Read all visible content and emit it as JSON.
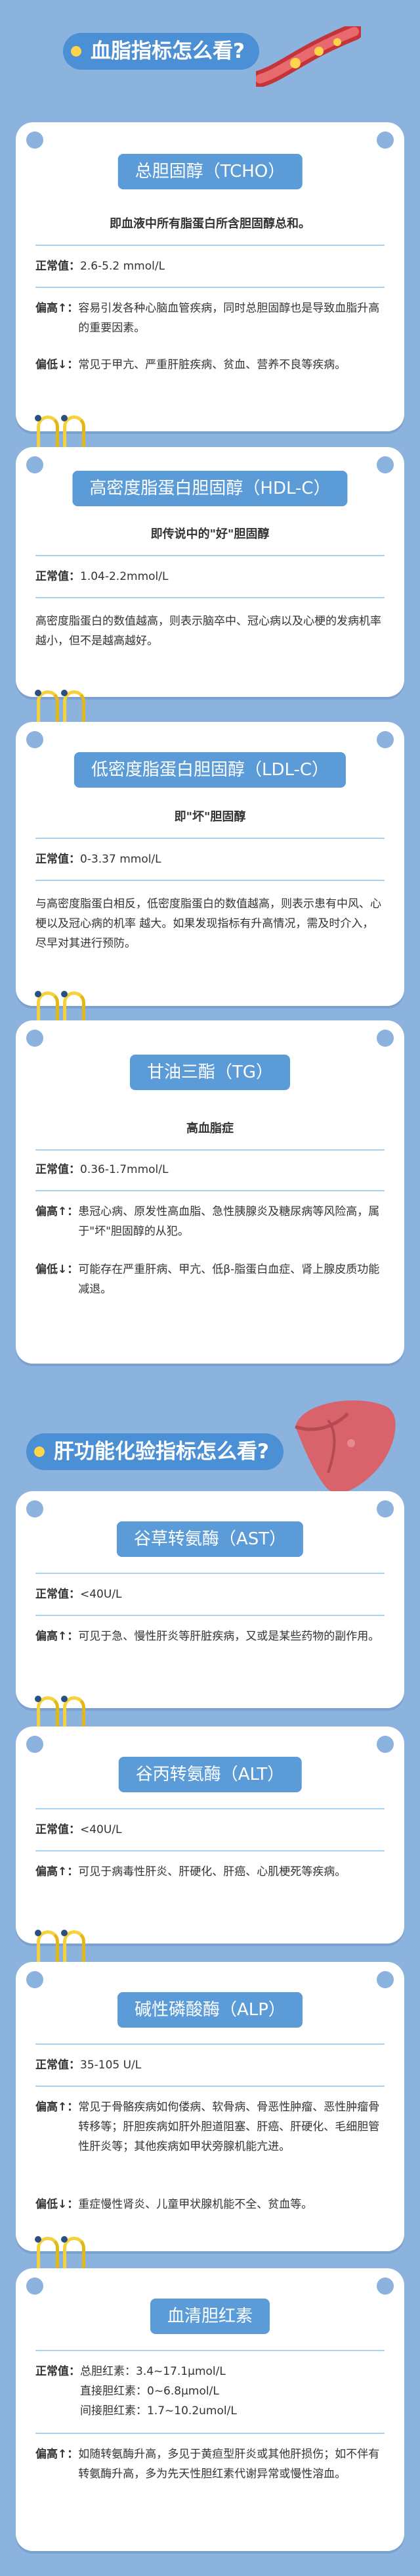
{
  "section1": {
    "title": "血脂指标怎么看?",
    "icon": "blood-vessel-icon"
  },
  "section2": {
    "title": "肝功能化验指标怎么看?",
    "icon": "liver-icon"
  },
  "cards": {
    "tcho": {
      "title": "总胆固醇（TCHO）",
      "subtitle": "即血液中所有脂蛋白所含胆固醇总和。",
      "normal_label": "正常值：",
      "normal_value": "2.6-5.2 mmol/L",
      "high_label": "偏高↑：",
      "high_text": "容易引发各种心脑血管疾病，同时总胆固醇也是导致血脂升高的重要因素。",
      "low_label": "偏低↓：",
      "low_text": "常见于甲亢、严重肝脏疾病、贫血、营养不良等疾病。"
    },
    "hdl": {
      "title": "高密度脂蛋白胆固醇（HDL-C）",
      "subtitle": "即传说中的\"好\"胆固醇",
      "normal_label": "正常值：",
      "normal_value": "1.04-2.2mmol/L",
      "desc": "高密度脂蛋白的数值越高，则表示脑卒中、冠心病以及心梗的发病机率越小，但不是越高越好。"
    },
    "ldl": {
      "title": "低密度脂蛋白胆固醇（LDL-C）",
      "subtitle": "即\"坏\"胆固醇",
      "normal_label": "正常值：",
      "normal_value": "0-3.37 mmol/L",
      "desc": "与高密度脂蛋白相反，低密度脂蛋白的数值越高，则表示患有中风、心梗以及冠心病的机率 越大。如果发现指标有升高情况，需及时介入，尽早对其进行预防。"
    },
    "tg": {
      "title": "甘油三酯（TG）",
      "subtitle": "高血脂症",
      "normal_label": "正常值：",
      "normal_value": "0.36-1.7mmol/L",
      "high_label": "偏高↑：",
      "high_text": "患冠心病、原发性高血脂、急性胰腺炎及糖尿病等风险高，属于\"坏\"胆固醇的从犯。",
      "low_label": "偏低↓：",
      "low_text": "可能存在严重肝病、甲亢、低β-脂蛋白血症、肾上腺皮质功能减退。"
    },
    "ast": {
      "title": "谷草转氨酶（AST）",
      "normal_label": "正常值：",
      "normal_value": "<40U/L",
      "high_label": "偏高↑：",
      "high_text": "可见于急、慢性肝炎等肝脏疾病，又或是某些药物的副作用。"
    },
    "alt": {
      "title": "谷丙转氨酶（ALT）",
      "normal_label": "正常值：",
      "normal_value": "<40U/L",
      "high_label": "偏高↑：",
      "high_text": "可见于病毒性肝炎、肝硬化、肝癌、心肌梗死等疾病。"
    },
    "alp": {
      "title": "碱性磷酸酶（ALP）",
      "normal_label": "正常值：",
      "normal_value": "35-105 U/L",
      "high_label": "偏高↑：",
      "high_text": "常见于骨骼疾病如佝偻病、软骨病、骨恶性肿瘤、恶性肿瘤骨转移等；肝胆疾病如肝外胆道阻塞、肝癌、肝硬化、毛细胆管性肝炎等；其他疾病如甲状旁腺机能亢进。",
      "low_label": "偏低↓：",
      "low_text": "重症慢性肾炎、儿童甲状腺机能不全、贫血等。"
    },
    "bil": {
      "title": "血清胆红素",
      "normal_label": "正常值：",
      "normal_lines": [
        "总胆红素：3.4~17.1μmol/L",
        "直接胆红素：0~6.8μmol/L",
        "间接胆红素：1.7~10.2umol/L"
      ],
      "high_label": "偏高↑：",
      "high_text": "如随转氨酶升高，多见于黄疸型肝炎或其他肝损伤；如不伴有转氨酶升高，多为先天性胆红素代谢异常或慢性溶血。"
    }
  }
}
